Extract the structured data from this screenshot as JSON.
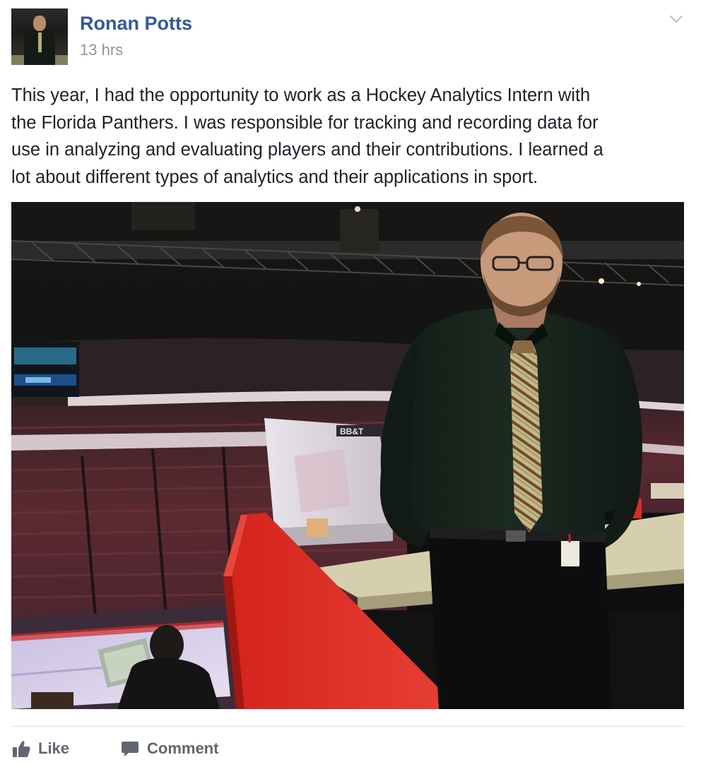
{
  "post": {
    "author": "Ronan Potts",
    "timestamp": "13 hrs",
    "text_lines": [
      "This year, I had the opportunity to work as a Hockey Analytics Intern with",
      "the Florida Panthers. I was responsible for tracking and recording data for",
      "use in analyzing and evaluating players and their contributions. I learned a",
      "lot about different types of analytics and their applications in sport."
    ],
    "photo": {
      "scoreboard_text": "BB&T"
    }
  },
  "actions": {
    "like_label": "Like",
    "comment_label": "Comment"
  },
  "icons": {
    "menu": "chevron-down-icon",
    "like": "thumbs-up-icon",
    "comment": "comment-bubble-icon"
  },
  "colors": {
    "author_link": "#365899",
    "timestamp": "#90949c",
    "body_text": "#1d2129",
    "action_text": "#606770"
  }
}
